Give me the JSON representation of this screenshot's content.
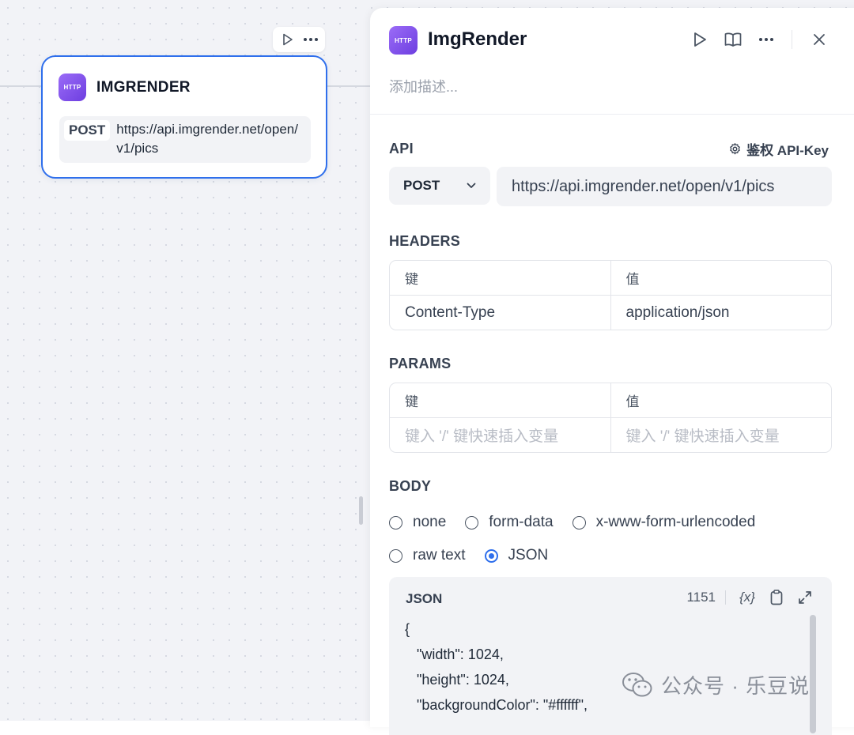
{
  "node": {
    "badge": "HTTP",
    "title": "IMGRENDER",
    "method": "POST",
    "url": "https://api.imgrender.net/open/v1/pics"
  },
  "panel": {
    "badge": "HTTP",
    "title": "ImgRender",
    "description_placeholder": "添加描述..."
  },
  "api": {
    "label": "API",
    "auth_label": "鉴权 API-Key",
    "method": "POST",
    "url": "https://api.imgrender.net/open/v1/pics"
  },
  "headers": {
    "label": "HEADERS",
    "columns": [
      "键",
      "值"
    ],
    "rows": [
      [
        "Content-Type",
        "application/json"
      ]
    ]
  },
  "params": {
    "label": "PARAMS",
    "columns": [
      "键",
      "值"
    ],
    "key_placeholder": "键入 '/' 键快速插入变量",
    "value_placeholder": "键入 '/' 键快速插入变量"
  },
  "body": {
    "label": "BODY",
    "options": [
      "none",
      "form-data",
      "x-www-form-urlencoded",
      "raw text",
      "JSON"
    ],
    "selected": "JSON",
    "json_label": "JSON",
    "char_count": "1151",
    "variable_icon_label": "{x}",
    "code_lines": [
      "{",
      "   \"width\": 1024,",
      "   \"height\": 1024,",
      "   \"backgroundColor\": \"#ffffff\","
    ]
  },
  "watermark": "公众号 · 乐豆说",
  "colors": {
    "accent": "#2f6fec",
    "badge": "#7c4dea"
  },
  "icons": [
    "play-icon",
    "more-icon",
    "book-icon",
    "close-icon",
    "gear-icon",
    "chevron-down-icon",
    "copy-icon",
    "expand-icon",
    "wechat-icon"
  ]
}
